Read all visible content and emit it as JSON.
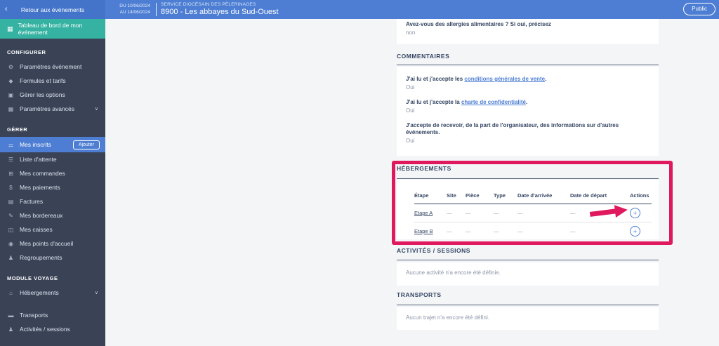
{
  "colors": {
    "topbar_blue": "#4d7ed3",
    "sidebar_dark": "#3a4356",
    "dashboard_teal": "#35b2a2",
    "highlight_pink": "#e0195f",
    "link_blue": "#4d7ed3",
    "heading_navy": "#344563"
  },
  "icons": {
    "back": "chevron-left",
    "chevron_down": "chevron-down",
    "dashboard": "grid"
  },
  "topbar": {
    "back_label": "Retour aux événements",
    "date_from": "DU 10/06/2024",
    "date_to": "AU 14/06/2024",
    "org": "SERVICE DIOCÉSAIN DES PÈLERINAGES",
    "event_title": "8900 - Les abbayes du Sud-Ouest",
    "public_label": "Public"
  },
  "sidebar": {
    "dashboard_label": "Tableau de bord de mon événement",
    "items": [
      {
        "type": "header",
        "label": "CONFIGURER"
      },
      {
        "type": "item",
        "icon": "gear",
        "label": "Paramètres événement"
      },
      {
        "type": "item",
        "icon": "tag",
        "label": "Formules et tarifs"
      },
      {
        "type": "item",
        "icon": "card",
        "label": "Gérer les options"
      },
      {
        "type": "item",
        "icon": "grid",
        "label": "Paramètres avancés",
        "expandable": true
      },
      {
        "type": "header",
        "label": "GÉRER"
      },
      {
        "type": "item",
        "icon": "users",
        "label": "Mes inscrits",
        "active": true,
        "action_label": "Ajouter"
      },
      {
        "type": "item",
        "icon": "list",
        "label": "Liste d'attente"
      },
      {
        "type": "item",
        "icon": "cart",
        "label": "Mes commandes"
      },
      {
        "type": "item",
        "icon": "dollar",
        "label": "Mes paiements"
      },
      {
        "type": "item",
        "icon": "file",
        "label": "Factures"
      },
      {
        "type": "item",
        "icon": "note",
        "label": "Mes bordereaux"
      },
      {
        "type": "item",
        "icon": "cash",
        "label": "Mes caisses"
      },
      {
        "type": "item",
        "icon": "pin",
        "label": "Mes points d'accueil"
      },
      {
        "type": "item",
        "icon": "person",
        "label": "Regroupements"
      },
      {
        "type": "header",
        "label": "MODULE VOYAGE"
      },
      {
        "type": "item",
        "icon": "home",
        "label": "Hébergements",
        "expandable": true
      },
      {
        "type": "item",
        "icon": "bus",
        "label": "Transports"
      },
      {
        "type": "item",
        "icon": "group",
        "label": "Activités / sessions"
      }
    ]
  },
  "main": {
    "allergy": {
      "question": "Avez-vous des allergies alimentaires ? Si oui, précisez",
      "answer": "non"
    },
    "comments": {
      "title": "COMMENTAIRES",
      "items": [
        {
          "text": "J'ai lu et j'accepte les ",
          "link": "conditions générales de vente",
          "suffix": ".",
          "answer": "Oui"
        },
        {
          "text": "J'ai lu et j'accepte la ",
          "link": "charte de confidentialité",
          "suffix": ".",
          "answer": "Oui"
        },
        {
          "text": "J'accepte de recevoir, de la part de l'organisateur, des informations sur d'autres événements.",
          "link": "",
          "suffix": "",
          "answer": "Oui"
        }
      ]
    },
    "hebergements": {
      "title": "HÉBERGEMENTS",
      "columns": [
        "Étape",
        "Site",
        "Pièce",
        "Type",
        "Date d'arrivée",
        "Date de départ",
        "Actions"
      ],
      "rows": [
        {
          "label": "Etape A",
          "values": [
            "—",
            "—",
            "—",
            "—",
            "—"
          ]
        },
        {
          "label": "Etape B",
          "values": [
            "—",
            "—",
            "—",
            "—",
            "—"
          ]
        }
      ],
      "plus_label": "+"
    },
    "activities": {
      "title": "ACTIVITÉS / SESSIONS",
      "empty": "Aucune activité n'a encore été définie."
    },
    "transports": {
      "title": "TRANSPORTS",
      "empty": "Aucun trajet n'a encore été défini."
    }
  }
}
